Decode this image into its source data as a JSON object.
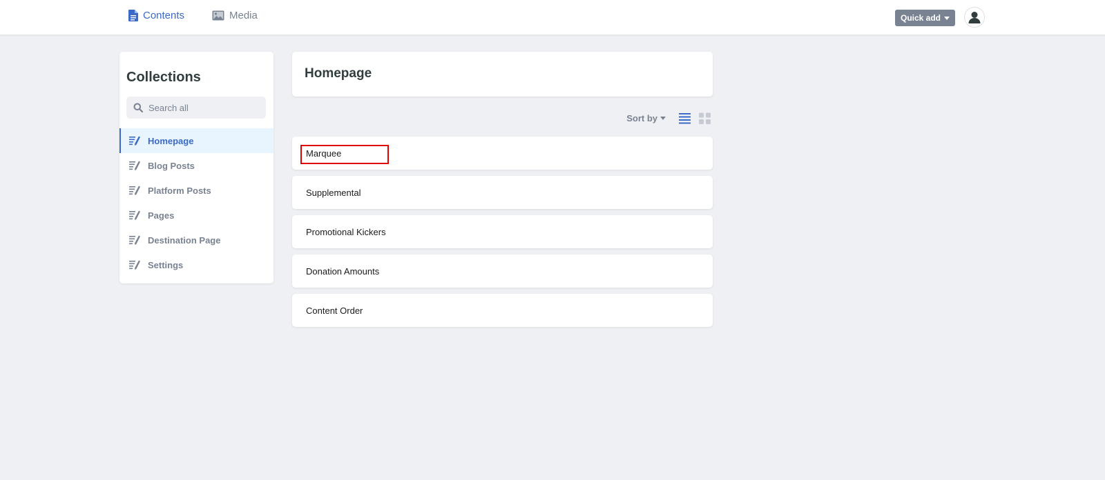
{
  "topnav": {
    "contents_label": "Contents",
    "media_label": "Media",
    "quick_add_label": "Quick add"
  },
  "sidebar": {
    "title": "Collections",
    "search_placeholder": "Search all",
    "items": [
      {
        "label": "Homepage",
        "active": true
      },
      {
        "label": "Blog Posts"
      },
      {
        "label": "Platform Posts"
      },
      {
        "label": "Pages"
      },
      {
        "label": "Destination Page"
      },
      {
        "label": "Settings"
      }
    ]
  },
  "main": {
    "title": "Homepage",
    "sort_label": "Sort by",
    "entries": [
      {
        "label": "Marquee",
        "highlighted": true
      },
      {
        "label": "Supplemental"
      },
      {
        "label": "Promotional Kickers"
      },
      {
        "label": "Donation Amounts"
      },
      {
        "label": "Content Order"
      }
    ]
  },
  "colors": {
    "accent": "#3a69c7",
    "muted": "#798291",
    "background": "#eff0f4",
    "active_bg": "#e8f5fe",
    "highlight": "#e10000"
  }
}
